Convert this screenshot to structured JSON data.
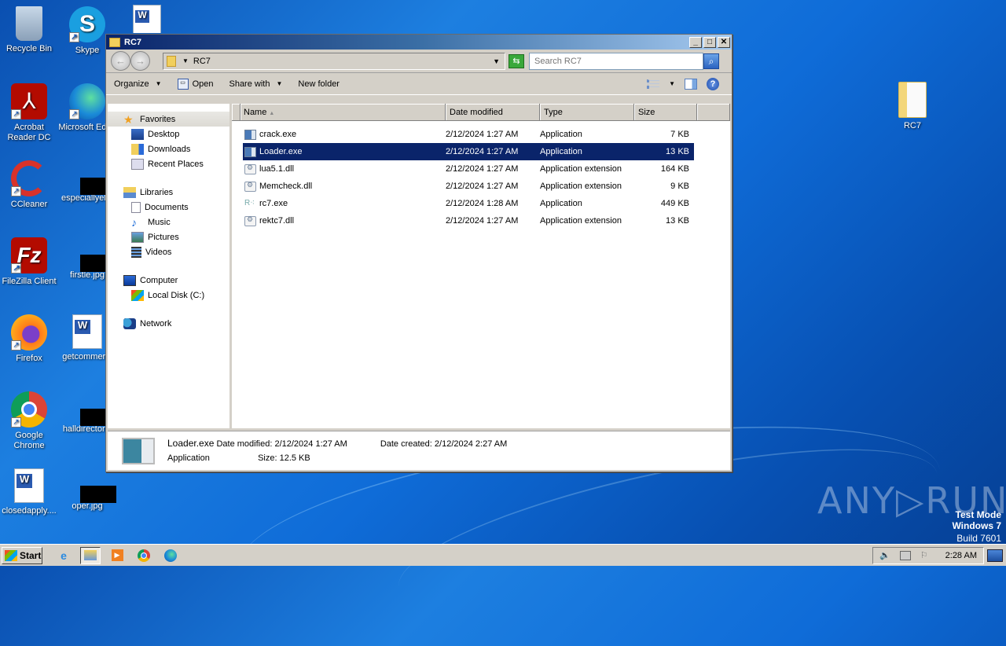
{
  "desktop": {
    "icons": [
      {
        "label": "Recycle Bin",
        "icon": "recycle-bin-icon"
      },
      {
        "label": "Skype",
        "icon": "skype-icon"
      },
      {
        "label": "Acrobat Reader DC",
        "icon": "acrobat-icon"
      },
      {
        "label": "Microsoft Edge",
        "icon": "edge-icon"
      },
      {
        "label": "CCleaner",
        "icon": "ccleaner-icon"
      },
      {
        "label": "especiallyel...",
        "icon": "image-file-icon"
      },
      {
        "label": "FileZilla Client",
        "icon": "filezilla-icon"
      },
      {
        "label": "firstle.jpg",
        "icon": "image-file-icon"
      },
      {
        "label": "Firefox",
        "icon": "firefox-icon"
      },
      {
        "label": "getcommer...",
        "icon": "word-doc-icon"
      },
      {
        "label": "Google Chrome",
        "icon": "chrome-icon"
      },
      {
        "label": "halldirector...",
        "icon": "image-file-icon"
      },
      {
        "label": "closedapply....",
        "icon": "word-doc-icon"
      },
      {
        "label": "oper.jpg",
        "icon": "image-file-icon"
      },
      {
        "label": "RC7",
        "icon": "folder-icon"
      }
    ],
    "watermark": {
      "line1": "Test Mode",
      "line2": "Windows 7",
      "line3": "Build 7601",
      "brand": "ANY▷RUN"
    }
  },
  "window": {
    "title": "RC7",
    "address": "RC7",
    "search_placeholder": "Search RC7",
    "toolbar": {
      "organize": "Organize",
      "open": "Open",
      "share_with": "Share with",
      "new_folder": "New folder"
    },
    "nav": {
      "favorites": "Favorites",
      "favorites_items": [
        "Desktop",
        "Downloads",
        "Recent Places"
      ],
      "libraries": "Libraries",
      "libraries_items": [
        "Documents",
        "Music",
        "Pictures",
        "Videos"
      ],
      "computer": "Computer",
      "computer_items": [
        "Local Disk (C:)"
      ],
      "network": "Network"
    },
    "columns": {
      "name": "Name",
      "date": "Date modified",
      "type": "Type",
      "size": "Size"
    },
    "files": [
      {
        "name": "crack.exe",
        "date": "2/12/2024 1:27 AM",
        "type": "Application",
        "size": "7 KB",
        "kind": "exe"
      },
      {
        "name": "Loader.exe",
        "date": "2/12/2024 1:27 AM",
        "type": "Application",
        "size": "13 KB",
        "kind": "exe",
        "selected": true
      },
      {
        "name": "lua5.1.dll",
        "date": "2/12/2024 1:27 AM",
        "type": "Application extension",
        "size": "164 KB",
        "kind": "dll"
      },
      {
        "name": "Memcheck.dll",
        "date": "2/12/2024 1:27 AM",
        "type": "Application extension",
        "size": "9 KB",
        "kind": "dll"
      },
      {
        "name": "rc7.exe",
        "date": "2/12/2024 1:28 AM",
        "type": "Application",
        "size": "449 KB",
        "kind": "rc"
      },
      {
        "name": "rektc7.dll",
        "date": "2/12/2024 1:27 AM",
        "type": "Application extension",
        "size": "13 KB",
        "kind": "dll"
      }
    ],
    "details": {
      "name": "Loader.exe",
      "type": "Application",
      "modified_label": "Date modified:",
      "modified": "2/12/2024 1:27 AM",
      "size_label": "Size:",
      "size": "12.5 KB",
      "created_label": "Date created:",
      "created": "2/12/2024 2:27 AM"
    }
  },
  "taskbar": {
    "start": "Start",
    "clock": "2:28 AM"
  }
}
